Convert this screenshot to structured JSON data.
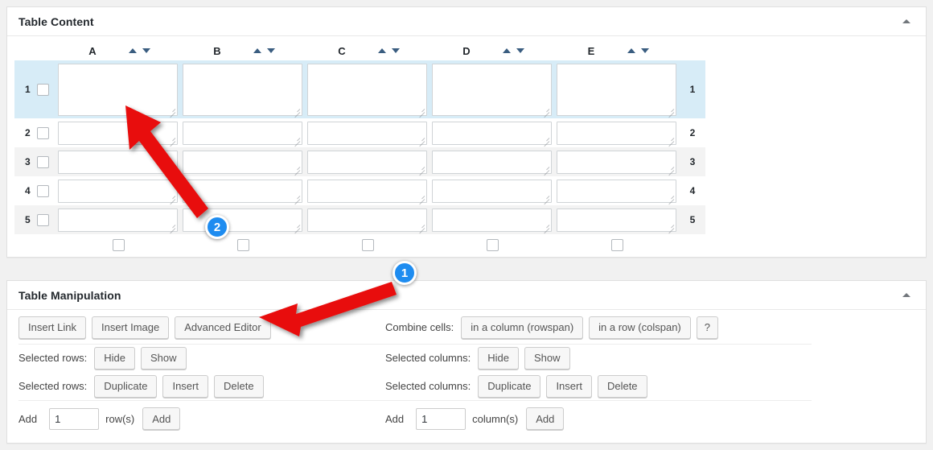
{
  "panels": {
    "content": {
      "title": "Table Content",
      "toggle_icon": "chevron-up-icon"
    },
    "manipulation": {
      "title": "Table Manipulation",
      "toggle_icon": "chevron-up-icon"
    }
  },
  "table": {
    "columns": [
      {
        "letter": "A",
        "sort_asc": "▲",
        "sort_desc": "▼"
      },
      {
        "letter": "B",
        "sort_asc": "▲",
        "sort_desc": "▼"
      },
      {
        "letter": "C",
        "sort_asc": "▲",
        "sort_desc": "▼"
      },
      {
        "letter": "D",
        "sort_asc": "▲",
        "sort_desc": "▼"
      },
      {
        "letter": "E",
        "sort_asc": "▲",
        "sort_desc": "▼"
      }
    ],
    "rows": [
      {
        "number": "1",
        "selected": true,
        "cells": [
          "",
          "",
          "",
          "",
          ""
        ]
      },
      {
        "number": "2",
        "selected": false,
        "cells": [
          "",
          "",
          "",
          "",
          ""
        ]
      },
      {
        "number": "3",
        "selected": false,
        "cells": [
          "",
          "",
          "",
          "",
          ""
        ]
      },
      {
        "number": "4",
        "selected": false,
        "cells": [
          "",
          "",
          "",
          "",
          ""
        ]
      },
      {
        "number": "5",
        "selected": false,
        "cells": [
          "",
          "",
          "",
          "",
          ""
        ]
      }
    ]
  },
  "manipulation": {
    "row1": {
      "insert_link": "Insert Link",
      "insert_image": "Insert Image",
      "advanced_editor": "Advanced Editor",
      "combine_label": "Combine cells:",
      "rowspan": "in a column (rowspan)",
      "colspan": "in a row (colspan)",
      "help": "?"
    },
    "row2": {
      "rows_label": "Selected rows:",
      "hide": "Hide",
      "show": "Show",
      "cols_label": "Selected columns:",
      "cols_hide": "Hide",
      "cols_show": "Show"
    },
    "row3": {
      "rows_label": "Selected rows:",
      "duplicate": "Duplicate",
      "insert": "Insert",
      "delete": "Delete",
      "cols_label": "Selected columns:",
      "cols_duplicate": "Duplicate",
      "cols_insert": "Insert",
      "cols_delete": "Delete"
    },
    "row4": {
      "add_prefix": "Add",
      "rows_value": "1",
      "rows_unit": "row(s)",
      "rows_add": "Add",
      "cols_add_prefix": "Add",
      "cols_value": "1",
      "cols_unit": "column(s)",
      "cols_add": "Add"
    }
  },
  "annotations": {
    "arrow_color": "#e8110b",
    "badge_color": "#1e8cf0",
    "markers": [
      {
        "label": "1",
        "target": "advanced-editor-button"
      },
      {
        "label": "2",
        "target": "table-cell-a1"
      }
    ]
  }
}
